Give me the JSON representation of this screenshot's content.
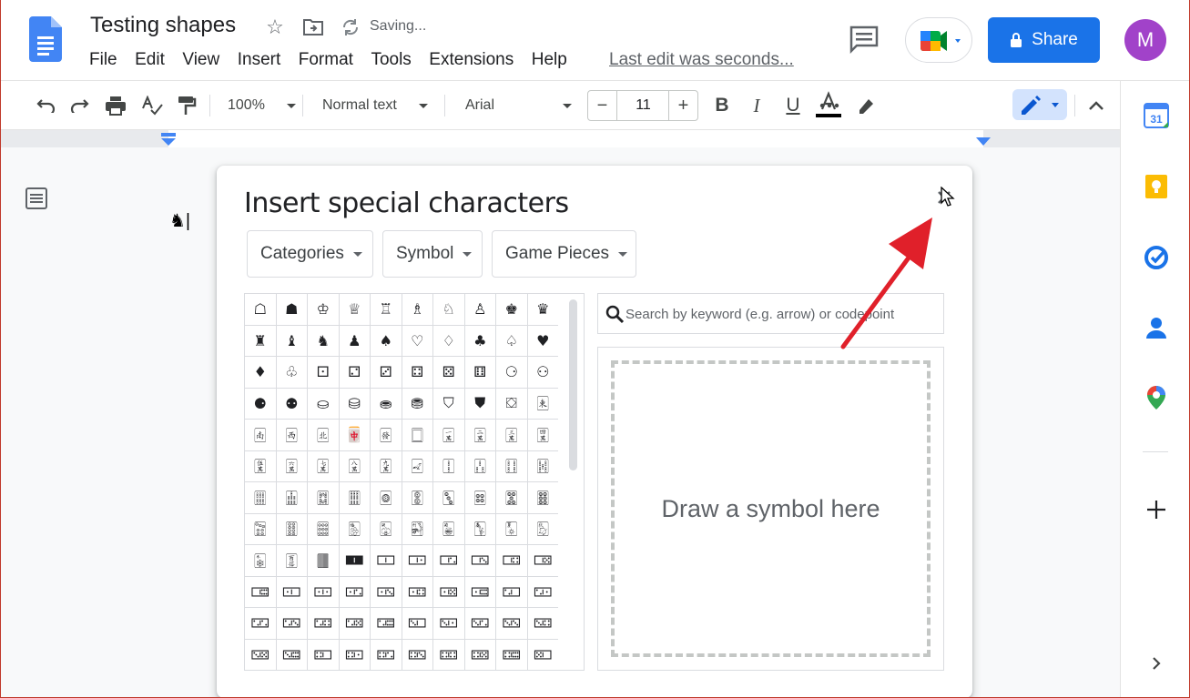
{
  "header": {
    "doc_title": "Testing shapes",
    "saving_status": "Saving...",
    "menus": [
      "File",
      "Edit",
      "View",
      "Insert",
      "Format",
      "Tools",
      "Extensions",
      "Help"
    ],
    "last_edit": "Last edit was seconds...",
    "share_label": "Share",
    "avatar_initial": "M"
  },
  "toolbar": {
    "zoom": "100%",
    "style": "Normal text",
    "font": "Arial",
    "font_size": "11",
    "minus": "−",
    "plus": "+"
  },
  "document": {
    "text": "♞|"
  },
  "dialog": {
    "title": "Insert special characters",
    "dropdowns": [
      "Categories",
      "Symbol",
      "Game Pieces"
    ],
    "search_placeholder": "Search by keyword (e.g. arrow) or codepoint",
    "draw_hint": "Draw a symbol here",
    "characters": [
      "☖",
      "☗",
      "♔",
      "♕",
      "♖",
      "♗",
      "♘",
      "♙",
      "♚",
      "♛",
      "♜",
      "♝",
      "♞",
      "♟",
      "♠",
      "♡",
      "♢",
      "♣",
      "♤",
      "♥",
      "♦",
      "♧",
      "⚀",
      "⚁",
      "⚂",
      "⚃",
      "⚄",
      "⚅",
      "⚆",
      "⚇",
      "⚈",
      "⚉",
      "⛀",
      "⛁",
      "⛂",
      "⛃",
      "⛉",
      "⛊",
      "⛋",
      "🀀",
      "🀁",
      "🀂",
      "🀃",
      "🀄",
      "🀅",
      "🀆",
      "🀇",
      "🀈",
      "🀉",
      "🀊",
      "🀋",
      "🀌",
      "🀍",
      "🀎",
      "🀏",
      "🀐",
      "🀑",
      "🀒",
      "🀓",
      "🀔",
      "🀕",
      "🀖",
      "🀗",
      "🀘",
      "🀙",
      "🀚",
      "🀛",
      "🀜",
      "🀝",
      "🀞",
      "🀟",
      "🀠",
      "🀡",
      "🀢",
      "🀣",
      "🀤",
      "🀥",
      "🀦",
      "🀧",
      "🀨",
      "🀩",
      "🀪",
      "🀫",
      "🀰",
      "🀱",
      "🀲",
      "🀳",
      "🀴",
      "🀵",
      "🀶",
      "🀷",
      "🀸",
      "🀹",
      "🀺",
      "🀻",
      "🀼",
      "🀽",
      "🀾",
      "🀿",
      "🁀",
      "🁁",
      "🁂",
      "🁃",
      "🁄",
      "🁅",
      "🁆",
      "🁇",
      "🁈",
      "🁉",
      "🁊",
      "🁋",
      "🁌",
      "🁍",
      "🁎",
      "🁏",
      "🁐",
      "🁑",
      "🁒",
      "🁓",
      "🁔"
    ]
  },
  "colors": {
    "share_blue": "#1a73e8",
    "avatar_purple": "#a142c9",
    "annotation_red": "#e0202a"
  }
}
